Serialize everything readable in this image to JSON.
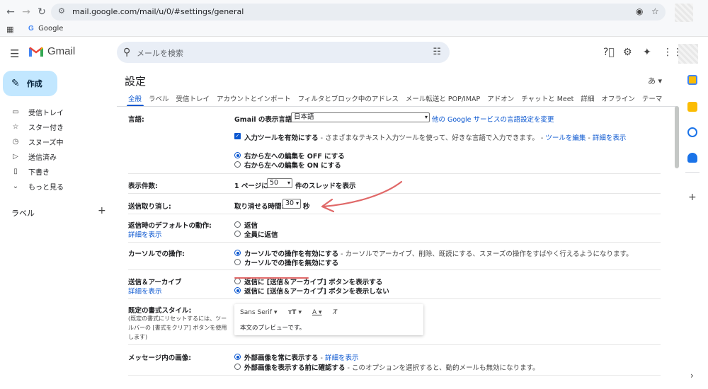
{
  "browser": {
    "url": "mail.google.com/mail/u/0/#settings/general",
    "bookmark": "Google"
  },
  "gmail": {
    "brand": "Gmail",
    "search_placeholder": "メールを検索"
  },
  "compose": {
    "label": "作成"
  },
  "nav": {
    "items": [
      {
        "label": "受信トレイ",
        "icon": "inbox-icon"
      },
      {
        "label": "スター付き",
        "icon": "star-icon"
      },
      {
        "label": "スヌーズ中",
        "icon": "clock-icon"
      },
      {
        "label": "送信済み",
        "icon": "send-icon"
      },
      {
        "label": "下書き",
        "icon": "draft-icon"
      },
      {
        "label": "もっと見る",
        "icon": "chevron-down-icon"
      }
    ],
    "labels_title": "ラベル"
  },
  "settings": {
    "title": "設定",
    "lang_toggle": "あ",
    "tabs": [
      "全般",
      "ラベル",
      "受信トレイ",
      "アカウントとインポート",
      "フィルタとブロック中のアドレス",
      "メール転送と POP/IMAP",
      "アドオン",
      "チャットと Meet",
      "詳細",
      "オフライン",
      "テーマ"
    ],
    "language": {
      "label": "言語:",
      "display_lang_label": "Gmail の表示言語:",
      "display_lang_value": "日本語",
      "other_link": "他の Google サービスの言語設定を変更",
      "input_tools_bold": "入力ツールを有効にする",
      "input_tools_desc": " - さまざまなテキスト入力ツールを使って、好きな言語で入力できます。 - ",
      "edit_tools_link": "ツールを編集",
      "sep": " - ",
      "details_link": "詳細を表示",
      "rtl_off": "右から左への編集を OFF にする",
      "rtl_on": "右から左への編集を ON にする"
    },
    "page_size": {
      "label": "表示件数:",
      "prefix": "1 ページに",
      "value": "50",
      "suffix": "件のスレッドを表示"
    },
    "undo_send": {
      "label": "送信取り消し:",
      "prefix": "取り消せる時間:",
      "value": "30",
      "suffix": "秒"
    },
    "reply_default": {
      "label": "返信時のデフォルトの動作:",
      "link": "詳細を表示",
      "opt1": "返信",
      "opt2": "全員に返信"
    },
    "hover": {
      "label": "カーソルでの操作:",
      "opt1_bold": "カーソルでの操作を有効にする",
      "opt1_desc": " - カーソルでアーカイブ、削除、既読にする、スヌーズの操作をすばやく行えるようになります。",
      "opt2": "カーソルでの操作を無効にする"
    },
    "send_archive": {
      "label": "送信＆アーカイブ",
      "link": "詳細を表示",
      "opt1": "返信に [送信＆アーカイブ] ボタンを表示する",
      "opt2": "返信に [送信＆アーカイブ] ボタンを表示しない"
    },
    "text_style": {
      "label": "既定の書式スタイル:",
      "sub": "(既定の書式にリセットするには、ツールバーの [書式をクリア] ボタンを使用します)",
      "font": "Sans Serif",
      "preview": "本文のプレビューです。"
    },
    "images": {
      "label": "メッセージ内の画像:",
      "opt1_bold": "外部画像を常に表示する",
      "opt1_sep": " - ",
      "opt1_link": "詳細を表示",
      "opt2_bold": "外部画像を表示する前に確認する",
      "opt2_desc": " - このオプションを選択すると、動的メールも無効になります。"
    }
  },
  "colors": {
    "accent": "#0b57d0",
    "compose_bg": "#c2e7ff",
    "annotation": "#e06868"
  }
}
